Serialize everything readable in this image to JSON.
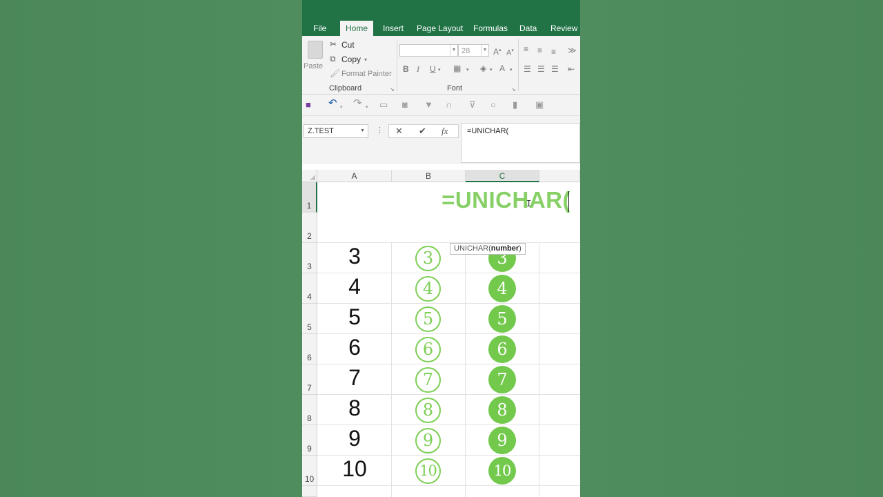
{
  "ribbon": {
    "tabs": [
      "File",
      "Home",
      "Insert",
      "Page Layout",
      "Formulas",
      "Data",
      "Review"
    ],
    "active_tab": "Home",
    "clipboard": {
      "paste": "Paste",
      "cut": "Cut",
      "copy": "Copy",
      "format_painter": "Format Painter",
      "group_label": "Clipboard"
    },
    "font": {
      "font_name": "",
      "font_size": "28",
      "bold": "B",
      "italic": "I",
      "underline": "U",
      "group_label": "Font"
    }
  },
  "formula_bar": {
    "name_box": "Z.TEST",
    "formula": "=UNICHAR("
  },
  "sheet": {
    "columns": [
      "A",
      "B",
      "C"
    ],
    "selected_column": "C",
    "rows": [
      1,
      2,
      3,
      4,
      5,
      6,
      7,
      8,
      9,
      10
    ],
    "selected_row": 1,
    "edit_text": "=UNICHAR(",
    "tooltip_fn": "UNICHAR(",
    "tooltip_arg": "number",
    "tooltip_close": ")",
    "col_a": [
      "3",
      "4",
      "5",
      "6",
      "7",
      "8",
      "9",
      "10"
    ],
    "col_b": [
      "③",
      "④",
      "⑤",
      "⑥",
      "⑦",
      "⑧",
      "⑨",
      "⑩"
    ],
    "col_c": [
      "3",
      "4",
      "5",
      "6",
      "7",
      "8",
      "9",
      "10"
    ]
  },
  "colors": {
    "excel_green": "#217346",
    "circle_green": "#72c94c",
    "formula_green": "#86d066"
  }
}
